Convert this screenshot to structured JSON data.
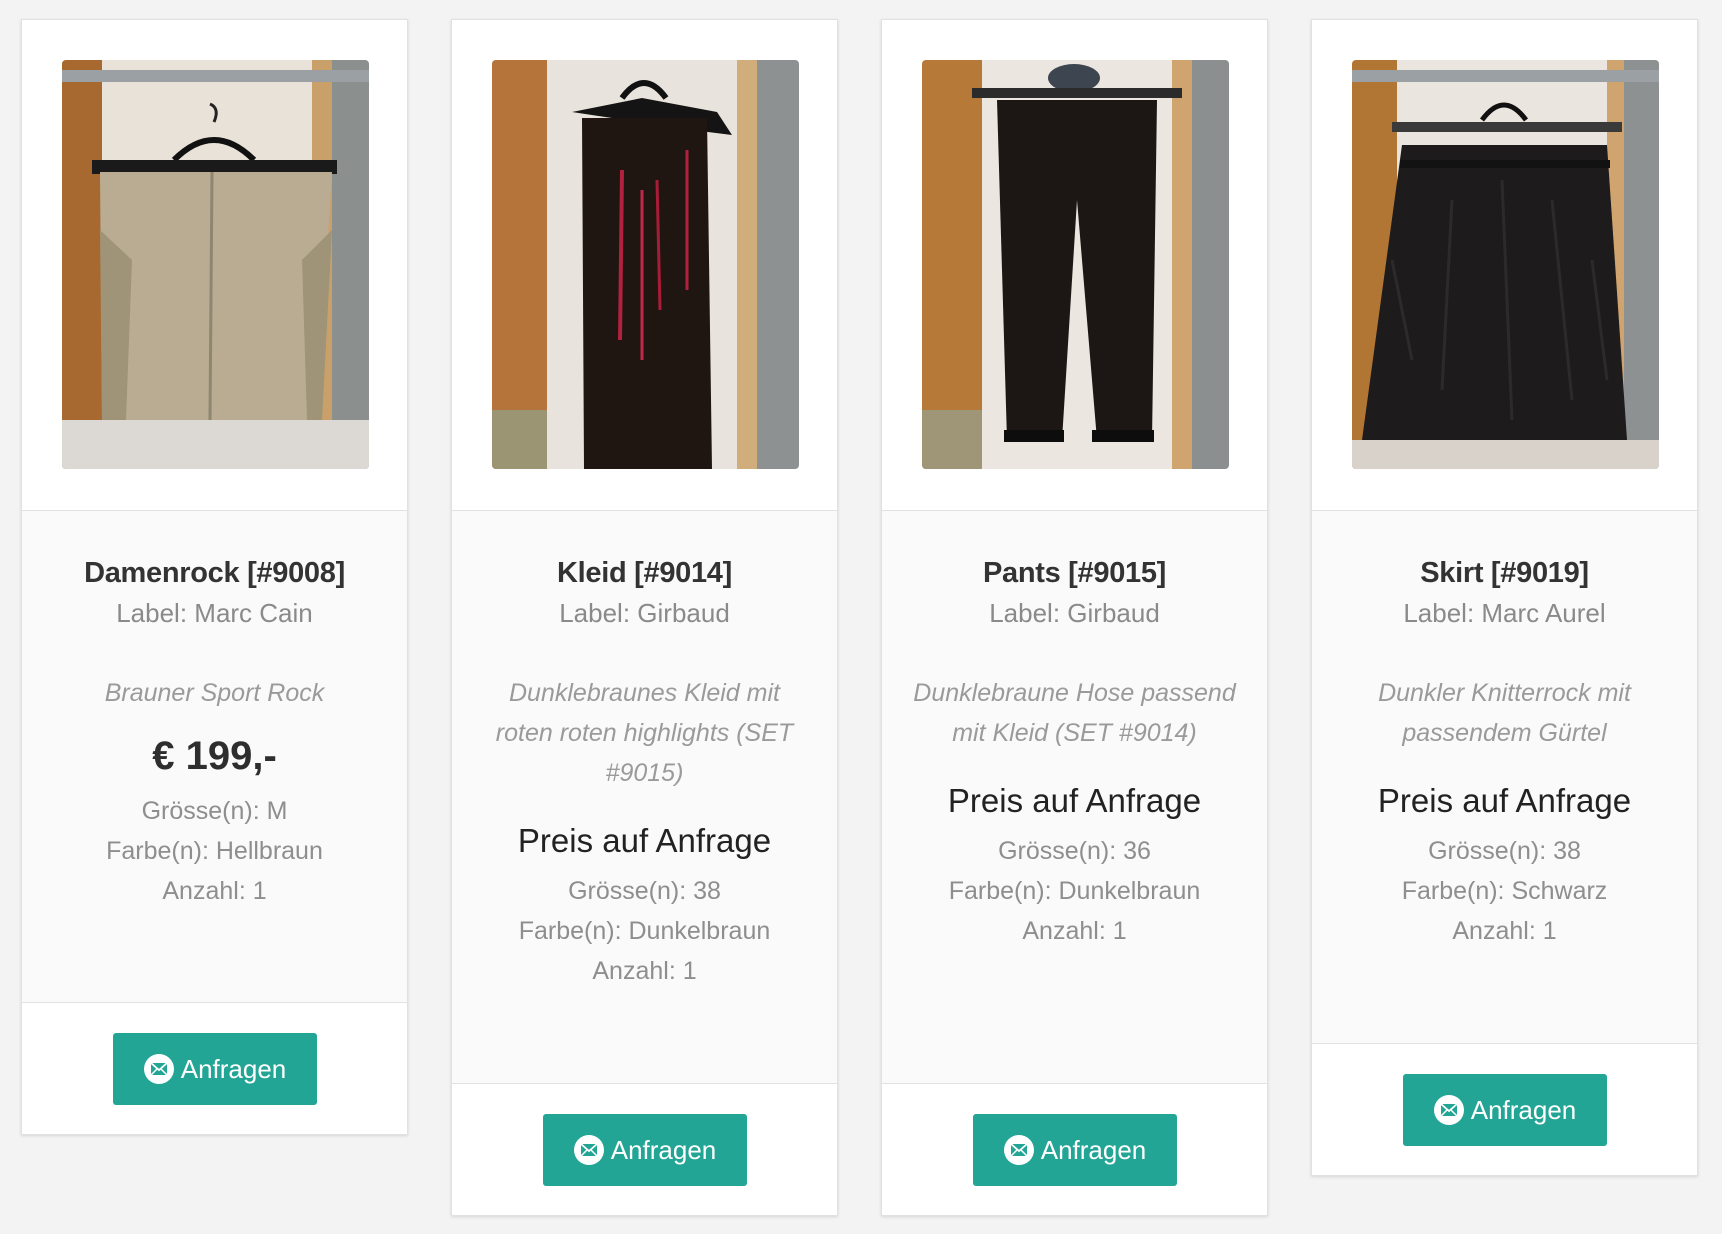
{
  "colors": {
    "accent": "#23a596",
    "page_background": "#f3f3f3",
    "card_body_background": "#fafafa"
  },
  "products": [
    {
      "title": "Damenrock [#9008]",
      "label": "Label: Marc Cain",
      "description": "Brauner Sport Rock",
      "price": "€ 199,-",
      "size": "Grösse(n): M",
      "color": "Farbe(n): Hellbraun",
      "quantity": "Anzahl: 1",
      "button_label": "Anfragen",
      "button_icon": "envelope-icon"
    },
    {
      "title": "Kleid [#9014]",
      "label": "Label: Girbaud",
      "description": "Dunklebraunes Kleid mit roten roten highlights (SET #9015)",
      "price": "Preis auf Anfrage",
      "size": "Grösse(n): 38",
      "color": "Farbe(n): Dunkelbraun",
      "quantity": "Anzahl: 1",
      "button_label": "Anfragen",
      "button_icon": "envelope-icon"
    },
    {
      "title": "Pants [#9015]",
      "label": "Label: Girbaud",
      "description": "Dunklebraune Hose passend mit Kleid (SET #9014)",
      "price": "Preis auf Anfrage",
      "size": "Grösse(n): 36",
      "color": "Farbe(n): Dunkelbraun",
      "quantity": "Anzahl: 1",
      "button_label": "Anfragen",
      "button_icon": "envelope-icon"
    },
    {
      "title": "Skirt [#9019]",
      "label": "Label: Marc Aurel",
      "description": "Dunkler Knitterrock mit passendem Gürtel",
      "price": "Preis auf Anfrage",
      "size": "Grösse(n): 38",
      "color": "Farbe(n): Schwarz",
      "quantity": "Anzahl: 1",
      "button_label": "Anfragen",
      "button_icon": "envelope-icon"
    }
  ]
}
